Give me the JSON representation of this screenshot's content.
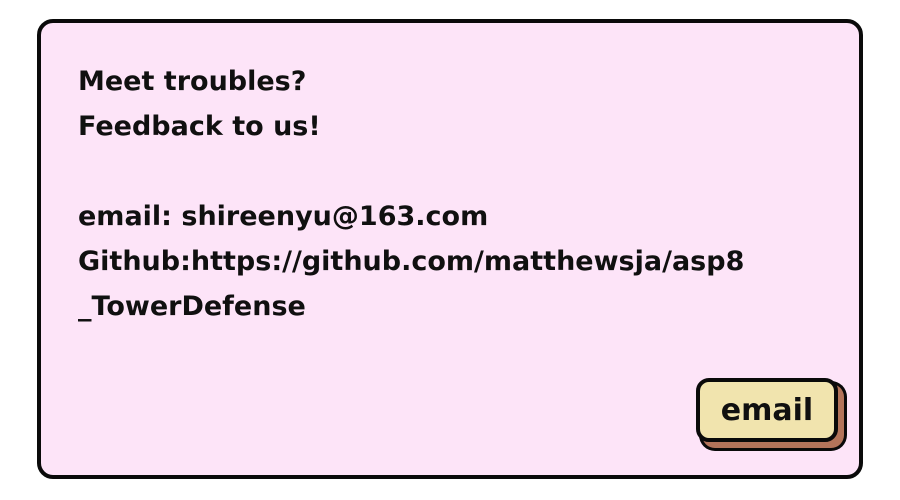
{
  "dialog": {
    "line1": "Meet troubles?",
    "line2": "Feedback to us!",
    "email_line": "email: shireenyu@163.com",
    "github_line1": "Github:https://github.com/matthewsja/asp8",
    "github_line2": "_TowerDefense"
  },
  "actions": {
    "email_label": "email"
  },
  "colors": {
    "panel_bg": "#fde4f8",
    "button_bg": "#f1e4ae",
    "button_shadow": "#b3745a",
    "border": "#0a0a0a"
  }
}
